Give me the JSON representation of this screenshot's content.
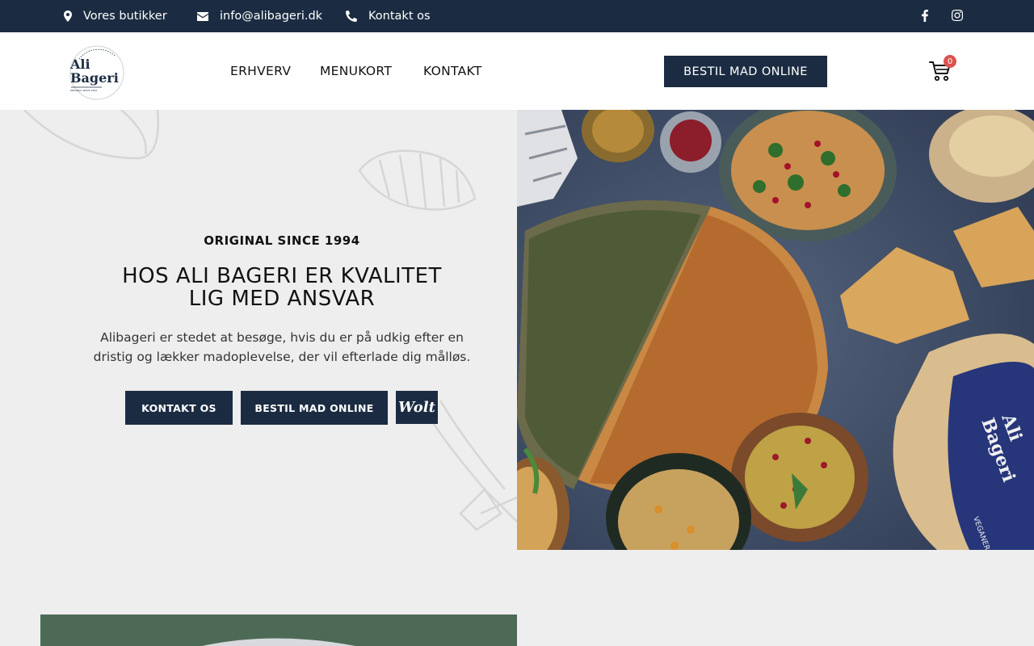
{
  "topbar": {
    "stores": "Vores butikker",
    "email": "info@alibageri.dk",
    "contact": "Kontakt os",
    "icons": [
      "map-marker-icon",
      "envelope-icon",
      "phone-icon",
      "facebook-icon",
      "instagram-icon"
    ]
  },
  "header": {
    "logo": {
      "line1": "Ali",
      "line2": "Bageri",
      "ring": "MADE FROM ONLY",
      "since": "ORIGINAL SINCE 1994"
    },
    "nav": [
      "ERHVERV",
      "MENUKORT",
      "KONTAKT"
    ],
    "order_button": "BESTIL MAD ONLINE",
    "cart_count": "0"
  },
  "hero": {
    "eyebrow": "ORIGINAL SINCE 1994",
    "title_line1": "HOS ALI BAGERI ER KVALITET",
    "title_line2": "LIG MED ANSVAR",
    "description": "Alibageri er stedet at besøge, hvis du er på udkig efter en dristig og lækker madoplevelse, der vil efterlade dig målløs.",
    "buttons": [
      "KONTAKT OS",
      "BESTIL MAD ONLINE"
    ],
    "wolt_label": "Wolt",
    "bag_text": {
      "line1": "Ali",
      "line2": "Bageri",
      "line3": "VEGANER"
    }
  },
  "colors": {
    "navy": "#1b2c42",
    "badge": "#d9534f",
    "background": "#eeeeee"
  }
}
